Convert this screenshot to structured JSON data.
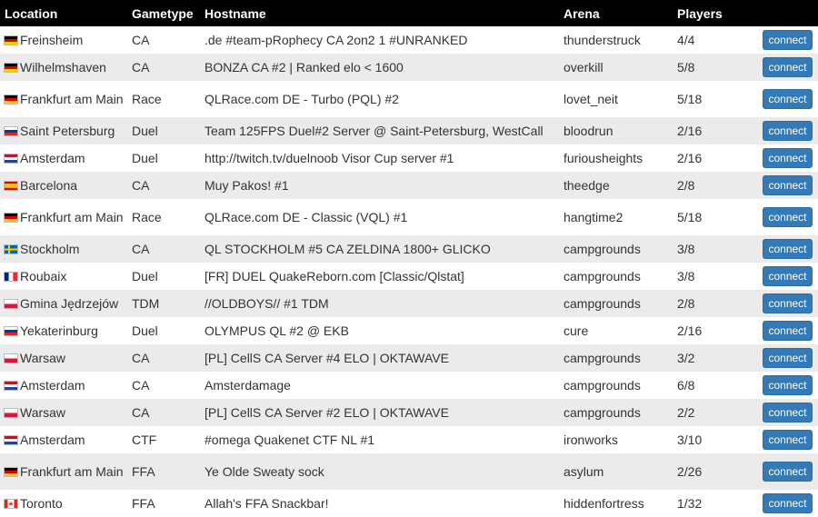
{
  "table": {
    "headers": {
      "location": "Location",
      "gametype": "Gametype",
      "hostname": "Hostname",
      "arena": "Arena",
      "players": "Players"
    },
    "connect_label": "connect",
    "rows": [
      {
        "flag": "de",
        "location": "Freinsheim",
        "gametype": "CA",
        "hostname": ".de #team-pRophecy CA 2on2 1 #UNRANKED",
        "arena": "thunderstruck",
        "players": "4/4"
      },
      {
        "flag": "de",
        "location": "Wilhelmshaven",
        "gametype": "CA",
        "hostname": "BONZA CA #2 | Ranked elo < 1600",
        "arena": "overkill",
        "players": "5/8"
      },
      {
        "flag": "de",
        "location": "Frankfurt am Main",
        "gametype": "Race",
        "hostname": "QLRace.com DE - Turbo (PQL) #2",
        "arena": "lovet_neit",
        "players": "5/18"
      },
      {
        "flag": "ru",
        "location": "Saint Petersburg",
        "gametype": "Duel",
        "hostname": "Team 125FPS Duel#2 Server @ Saint-Petersburg, WestCall",
        "arena": "bloodrun",
        "players": "2/16"
      },
      {
        "flag": "nl",
        "location": "Amsterdam",
        "gametype": "Duel",
        "hostname": "http://twitch.tv/duelnoob Visor Cup server #1",
        "arena": "furiousheights",
        "players": "2/16"
      },
      {
        "flag": "es",
        "location": "Barcelona",
        "gametype": "CA",
        "hostname": "Muy Pakos! #1",
        "arena": "theedge",
        "players": "2/8"
      },
      {
        "flag": "de",
        "location": "Frankfurt am Main",
        "gametype": "Race",
        "hostname": "QLRace.com DE - Classic (VQL) #1",
        "arena": "hangtime2",
        "players": "5/18"
      },
      {
        "flag": "se",
        "location": "Stockholm",
        "gametype": "CA",
        "hostname": "QL STOCKHOLM #5 CA ZELDINA 1800+ GLICKO",
        "arena": "campgrounds",
        "players": "3/8"
      },
      {
        "flag": "fr",
        "location": "Roubaix",
        "gametype": "Duel",
        "hostname": "[FR] DUEL QuakeReborn.com [Classic/Qlstat]",
        "arena": "campgrounds",
        "players": "3/8"
      },
      {
        "flag": "pl",
        "location": "Gmina Jędrzejów",
        "gametype": "TDM",
        "hostname": "//OLDBOYS// #1 TDM",
        "arena": "campgrounds",
        "players": "2/8"
      },
      {
        "flag": "ru",
        "location": "Yekaterinburg",
        "gametype": "Duel",
        "hostname": "OLYMPUS QL #2 @ EKB",
        "arena": "cure",
        "players": "2/16"
      },
      {
        "flag": "pl",
        "location": "Warsaw",
        "gametype": "CA",
        "hostname": "[PL] CellS CA Server #4 ELO | OKTAWAVE",
        "arena": "campgrounds",
        "players": "3/2"
      },
      {
        "flag": "nl",
        "location": "Amsterdam",
        "gametype": "CA",
        "hostname": "Amsterdamage",
        "arena": "campgrounds",
        "players": "6/8"
      },
      {
        "flag": "pl",
        "location": "Warsaw",
        "gametype": "CA",
        "hostname": "[PL] CellS CA Server #2 ELO | OKTAWAVE",
        "arena": "campgrounds",
        "players": "2/2"
      },
      {
        "flag": "nl",
        "location": "Amsterdam",
        "gametype": "CTF",
        "hostname": "#omega Quakenet CTF NL #1",
        "arena": "ironworks",
        "players": "3/10"
      },
      {
        "flag": "de",
        "location": "Frankfurt am Main",
        "gametype": "FFA",
        "hostname": "Ye Olde Sweaty sock",
        "arena": "asylum",
        "players": "2/26"
      },
      {
        "flag": "ca",
        "location": "Toronto",
        "gametype": "FFA",
        "hostname": "Allah's FFA Snackbar!",
        "arena": "hiddenfortress",
        "players": "1/32"
      }
    ]
  },
  "colors": {
    "header_bg": "#000000",
    "stripe": "#ebebeb",
    "button": "#337ab7"
  }
}
